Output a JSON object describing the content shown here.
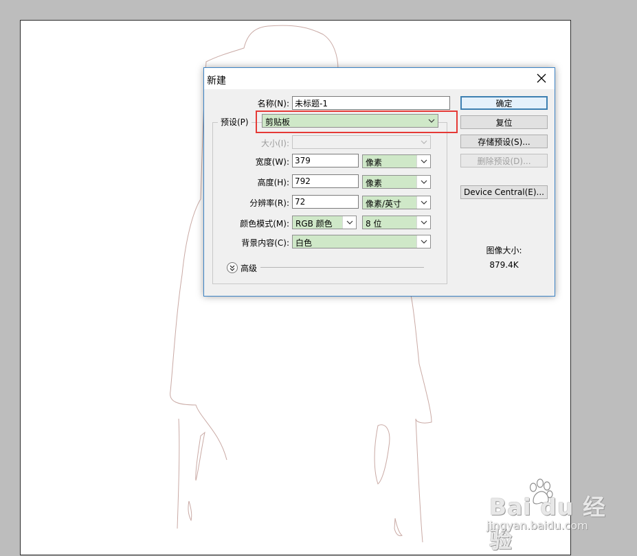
{
  "dialog": {
    "title": "新建",
    "name_label": "名称(N):",
    "name_value": "未标题-1",
    "preset_label": "预设(P)",
    "preset_value": "剪贴板",
    "size_label": "大小(I):",
    "width_label": "宽度(W):",
    "width_value": "379",
    "width_unit": "像素",
    "height_label": "高度(H):",
    "height_value": "792",
    "height_unit": "像素",
    "resolution_label": "分辨率(R):",
    "resolution_value": "72",
    "resolution_unit": "像素/英寸",
    "color_mode_label": "颜色模式(M):",
    "color_mode_value": "RGB 颜色",
    "bit_depth_value": "8 位",
    "background_label": "背景内容(C):",
    "background_value": "白色",
    "advanced_label": "高级",
    "image_size_label": "图像大小:",
    "image_size_value": "879.4K"
  },
  "buttons": {
    "ok": "确定",
    "reset": "复位",
    "save_preset": "存储预设(S)...",
    "delete_preset": "删除预设(D)...",
    "device_central": "Device Central(E)..."
  },
  "watermark": {
    "brand": "Bai du 经验",
    "url": "jingyan.baidu.com"
  },
  "colors": {
    "combo_fill": "#cfe8c8",
    "highlight": "#e53935",
    "dialog_border": "#3b82c4"
  },
  "icons": [
    "close-icon",
    "chevron-down-icon",
    "double-chevron-down-icon",
    "baidu-paw-icon"
  ]
}
